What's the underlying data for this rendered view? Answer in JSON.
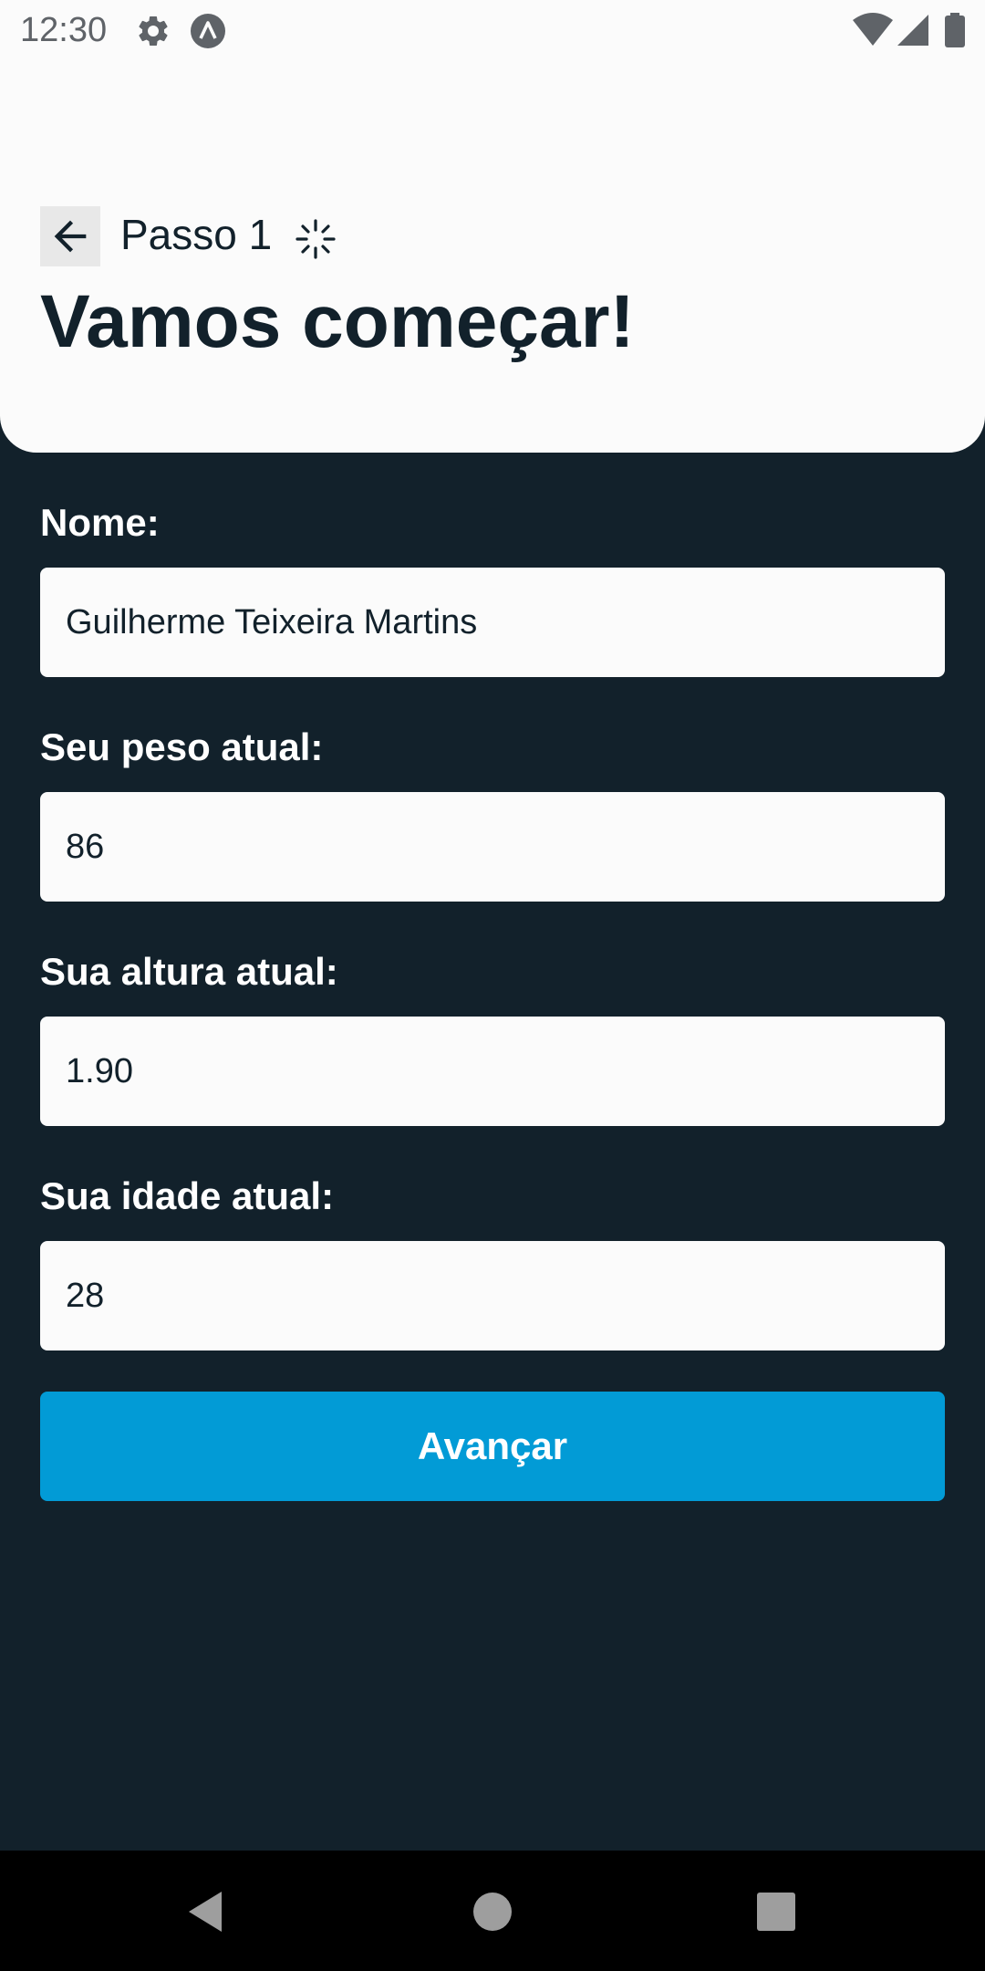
{
  "status_bar": {
    "time": "12:30",
    "icons": [
      "gear-icon",
      "app-notification-icon",
      "wifi-icon",
      "signal-icon",
      "battery-icon"
    ]
  },
  "header": {
    "step": "Passo 1",
    "title": "Vamos começar!"
  },
  "form": {
    "name_label": "Nome:",
    "name_value": "Guilherme Teixeira Martins",
    "weight_label": "Seu peso atual:",
    "weight_value": "86",
    "height_label": "Sua altura atual:",
    "height_value": "1.90",
    "age_label": "Sua idade atual:",
    "age_value": "28",
    "submit_label": "Avançar"
  },
  "nav_bar": {
    "buttons": [
      "back-triangle-icon",
      "home-circle-icon",
      "recents-square-icon"
    ]
  },
  "colors": {
    "background": "#12212b",
    "header_bg": "#fbfbfb",
    "accent": "#029bd6",
    "text_dark": "#12212b",
    "text_light": "#ffffff"
  }
}
